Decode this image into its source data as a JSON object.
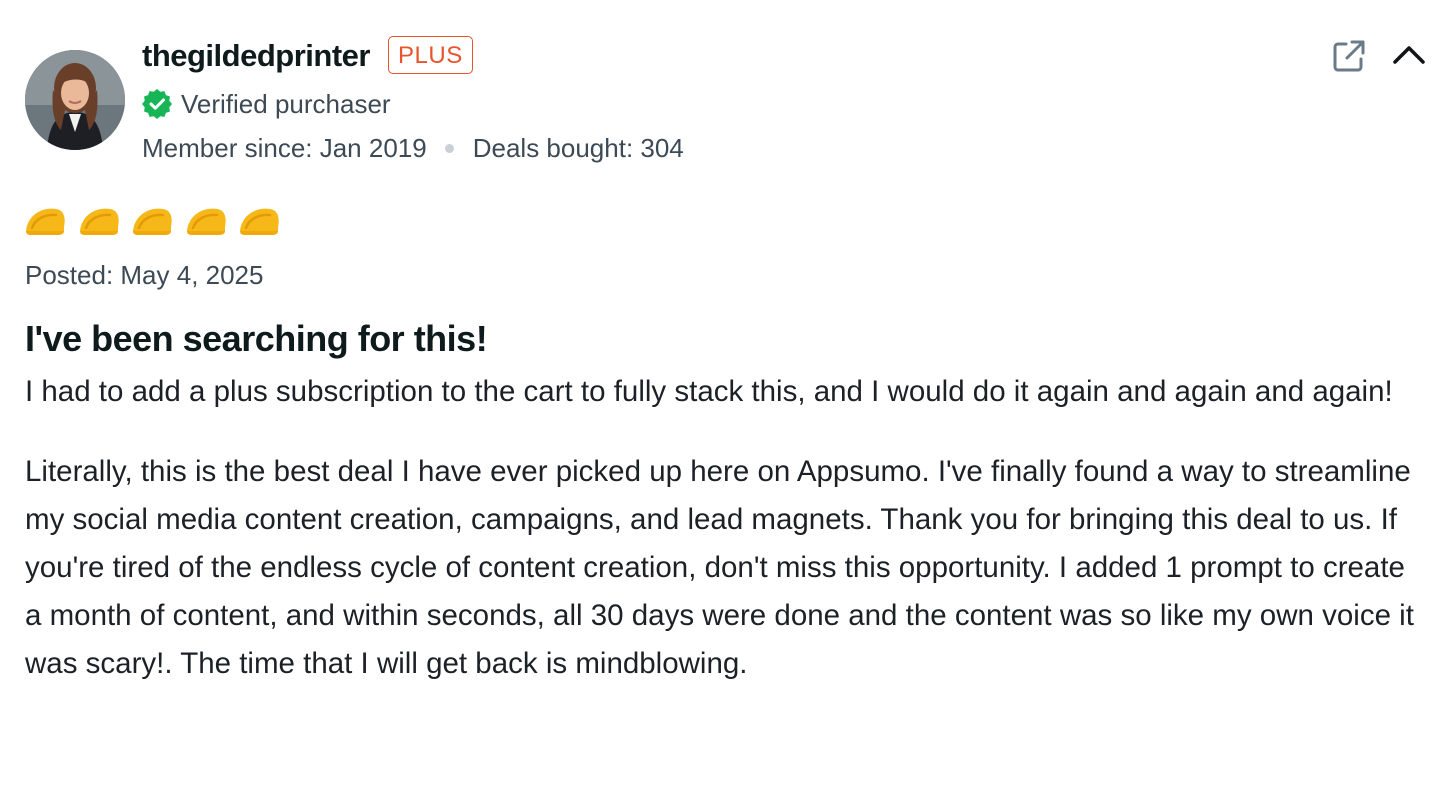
{
  "reviewer": {
    "username": "thegildedprinter",
    "badge": "PLUS",
    "verified_text": "Verified purchaser",
    "member_since": "Member since: Jan 2019",
    "deals_bought": "Deals bought: 304"
  },
  "actions": {
    "external_icon": "external-link-icon",
    "collapse_icon": "chevron-up-icon"
  },
  "rating": {
    "value": 5,
    "max": 5,
    "icon": "taco-icon",
    "color": "#f6b818"
  },
  "review": {
    "posted": "Posted: May 4, 2025",
    "title": "I've been searching for this!",
    "paragraphs": [
      "I had to add a plus subscription to the cart to fully stack this, and I would do it again and again and again!",
      "Literally, this is the best deal I have ever picked up here on Appsumo. I've finally found a way to streamline my social media content creation, campaigns, and lead magnets. Thank you for bringing this deal to us. If you're tired of the endless cycle of content creation, don't miss this opportunity. I added 1 prompt to create a month of content, and within seconds, all 30 days were done and the content was so like my own voice it was scary!. The time that I will get back is mindblowing."
    ]
  },
  "colors": {
    "badge": "#e8542c",
    "verified": "#18b556",
    "secondary_text": "#3d4a55",
    "heading": "#0e1a1c"
  }
}
